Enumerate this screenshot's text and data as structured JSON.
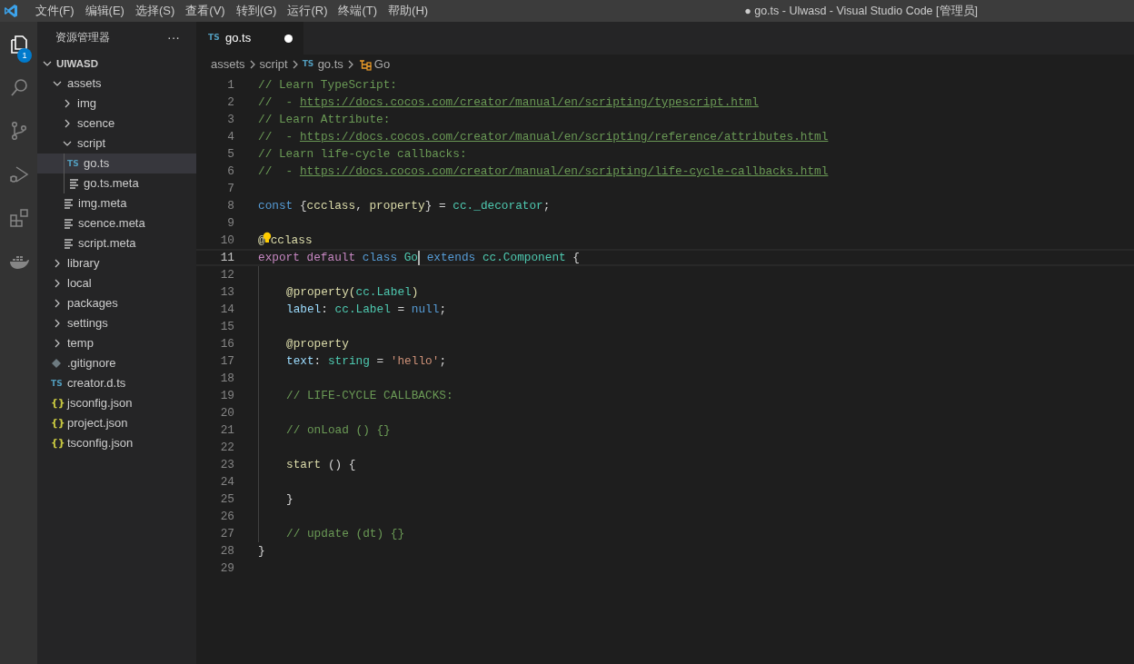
{
  "title_bar": {
    "menus": [
      "文件(F)",
      "编辑(E)",
      "选择(S)",
      "查看(V)",
      "转到(G)",
      "运行(R)",
      "终端(T)",
      "帮助(H)"
    ],
    "title": "● go.ts - Ulwasd - Visual Studio Code [管理员]"
  },
  "activity_bar": [
    {
      "kind": "files",
      "selected": true,
      "badge": "1"
    },
    {
      "kind": "search",
      "selected": false
    },
    {
      "kind": "source-control",
      "selected": false
    },
    {
      "kind": "run-debug",
      "selected": false
    },
    {
      "kind": "extensions",
      "selected": false
    },
    {
      "kind": "docker",
      "selected": false
    }
  ],
  "explorer": {
    "title": "资源管理器",
    "more": "···",
    "root": {
      "label": "UIWASD",
      "expanded": true
    },
    "items": [
      {
        "label": "assets",
        "kind": "folder",
        "expanded": true,
        "selected": false,
        "children": [
          {
            "label": "img",
            "kind": "folder",
            "expanded": false,
            "selected": false
          },
          {
            "label": "scence",
            "kind": "folder",
            "expanded": false,
            "selected": false
          },
          {
            "label": "script",
            "kind": "folder",
            "expanded": true,
            "selected": false,
            "children": [
              {
                "label": "go.ts",
                "kind": "ts",
                "glyph": "TS",
                "selected": true
              },
              {
                "label": "go.ts.meta",
                "kind": "meta",
                "selected": false
              }
            ]
          },
          {
            "label": "img.meta",
            "kind": "meta",
            "selected": false
          },
          {
            "label": "scence.meta",
            "kind": "meta",
            "selected": false
          },
          {
            "label": "script.meta",
            "kind": "meta",
            "selected": false
          }
        ]
      },
      {
        "label": "library",
        "kind": "folder",
        "expanded": false,
        "selected": false
      },
      {
        "label": "local",
        "kind": "folder",
        "expanded": false,
        "selected": false
      },
      {
        "label": "packages",
        "kind": "folder",
        "expanded": false,
        "selected": false
      },
      {
        "label": "settings",
        "kind": "folder",
        "expanded": false,
        "selected": false
      },
      {
        "label": "temp",
        "kind": "folder",
        "expanded": false,
        "selected": false
      },
      {
        "label": ".gitignore",
        "kind": "git",
        "selected": false
      },
      {
        "label": "creator.d.ts",
        "kind": "ts",
        "glyph": "TS",
        "selected": false
      },
      {
        "label": "jsconfig.json",
        "kind": "json",
        "glyph": "{}",
        "selected": false
      },
      {
        "label": "project.json",
        "kind": "json",
        "glyph": "{}",
        "selected": false
      },
      {
        "label": "tsconfig.json",
        "kind": "json",
        "glyph": "{}",
        "selected": false
      }
    ]
  },
  "tabs": [
    {
      "label": "go.ts",
      "glyph": "TS",
      "selected": true,
      "modified": true
    }
  ],
  "breadcrumbs": [
    {
      "label": "assets",
      "kind": "folder"
    },
    {
      "label": "script",
      "kind": "folder"
    },
    {
      "label": "go.ts",
      "kind": "ts",
      "glyph": "TS"
    },
    {
      "label": "Go",
      "kind": "symbol"
    }
  ],
  "editor": {
    "lines": [
      {
        "number": "1",
        "tokens": [
          {
            "text": "// Learn TypeScript:",
            "kind": "comment"
          }
        ]
      },
      {
        "number": "2",
        "tokens": [
          {
            "text": "//  - ",
            "kind": "comment"
          },
          {
            "text": "https://docs.cocos.com/creator/manual/en/scripting/typescript.html",
            "kind": "link"
          }
        ]
      },
      {
        "number": "3",
        "tokens": [
          {
            "text": "// Learn Attribute:",
            "kind": "comment"
          }
        ]
      },
      {
        "number": "4",
        "tokens": [
          {
            "text": "//  - ",
            "kind": "comment"
          },
          {
            "text": "https://docs.cocos.com/creator/manual/en/scripting/reference/attributes.html",
            "kind": "link"
          }
        ]
      },
      {
        "number": "5",
        "tokens": [
          {
            "text": "// Learn life-cycle callbacks:",
            "kind": "comment"
          }
        ]
      },
      {
        "number": "6",
        "tokens": [
          {
            "text": "//  - ",
            "kind": "comment"
          },
          {
            "text": "https://docs.cocos.com/creator/manual/en/scripting/life-cycle-callbacks.html",
            "kind": "link"
          }
        ]
      },
      {
        "number": "7"
      },
      {
        "number": "8",
        "tokens": [
          {
            "text": "const ",
            "kind": "keyword"
          },
          {
            "text": "{",
            "kind": "plain"
          },
          {
            "text": "ccclass",
            "kind": "func"
          },
          {
            "text": ", ",
            "kind": "plain"
          },
          {
            "text": "property",
            "kind": "func"
          },
          {
            "text": "} = ",
            "kind": "plain"
          },
          {
            "text": "cc._decorator",
            "kind": "type"
          },
          {
            "text": ";",
            "kind": "plain"
          }
        ]
      },
      {
        "number": "9"
      },
      {
        "number": "10",
        "lightbulb": true,
        "tokens": [
          {
            "text": "@",
            "kind": "func"
          },
          {
            "text": "cclass",
            "kind": "func"
          }
        ]
      },
      {
        "number": "11",
        "current": true,
        "tokens": [
          {
            "text": "export default ",
            "kind": "control"
          },
          {
            "text": "class ",
            "kind": "keyword"
          },
          {
            "text": "Go",
            "kind": "type",
            "cursor": true
          },
          {
            "text": " extends ",
            "kind": "keyword"
          },
          {
            "text": "cc.Component",
            "kind": "type"
          },
          {
            "text": " {",
            "kind": "plain"
          }
        ]
      },
      {
        "number": "12",
        "indented": true
      },
      {
        "number": "13",
        "indented": true,
        "tokens": [
          {
            "text": "@property(",
            "kind": "func"
          },
          {
            "text": "cc.Label",
            "kind": "type"
          },
          {
            "text": ")",
            "kind": "func"
          }
        ]
      },
      {
        "number": "14",
        "indented": true,
        "tokens": [
          {
            "text": "label",
            "kind": "variable"
          },
          {
            "text": ": ",
            "kind": "plain"
          },
          {
            "text": "cc.Label",
            "kind": "type"
          },
          {
            "text": " = ",
            "kind": "plain"
          },
          {
            "text": "null",
            "kind": "keyword"
          },
          {
            "text": ";",
            "kind": "plain"
          }
        ]
      },
      {
        "number": "15",
        "indented": true
      },
      {
        "number": "16",
        "indented": true,
        "tokens": [
          {
            "text": "@property",
            "kind": "func"
          }
        ]
      },
      {
        "number": "17",
        "indented": true,
        "tokens": [
          {
            "text": "text",
            "kind": "variable"
          },
          {
            "text": ": ",
            "kind": "plain"
          },
          {
            "text": "string",
            "kind": "type"
          },
          {
            "text": " = ",
            "kind": "plain"
          },
          {
            "text": "'hello'",
            "kind": "string"
          },
          {
            "text": ";",
            "kind": "plain"
          }
        ]
      },
      {
        "number": "18",
        "indented": true
      },
      {
        "number": "19",
        "indented": true,
        "tokens": [
          {
            "text": "// LIFE-CYCLE CALLBACKS:",
            "kind": "comment"
          }
        ]
      },
      {
        "number": "20",
        "indented": true
      },
      {
        "number": "21",
        "indented": true,
        "tokens": [
          {
            "text": "// onLoad () {}",
            "kind": "comment"
          }
        ]
      },
      {
        "number": "22",
        "indented": true
      },
      {
        "number": "23",
        "indented": true,
        "tokens": [
          {
            "text": "start",
            "kind": "func"
          },
          {
            "text": " () {",
            "kind": "plain"
          }
        ]
      },
      {
        "number": "24",
        "indented": true
      },
      {
        "number": "25",
        "indented": true,
        "tokens": [
          {
            "text": "}",
            "kind": "plain"
          }
        ]
      },
      {
        "number": "26",
        "indented": true
      },
      {
        "number": "27",
        "indented": true,
        "tokens": [
          {
            "text": "// update (dt) {}",
            "kind": "comment"
          }
        ]
      },
      {
        "number": "28",
        "tokens": [
          {
            "text": "}",
            "kind": "plain"
          }
        ]
      },
      {
        "number": "29"
      }
    ]
  }
}
